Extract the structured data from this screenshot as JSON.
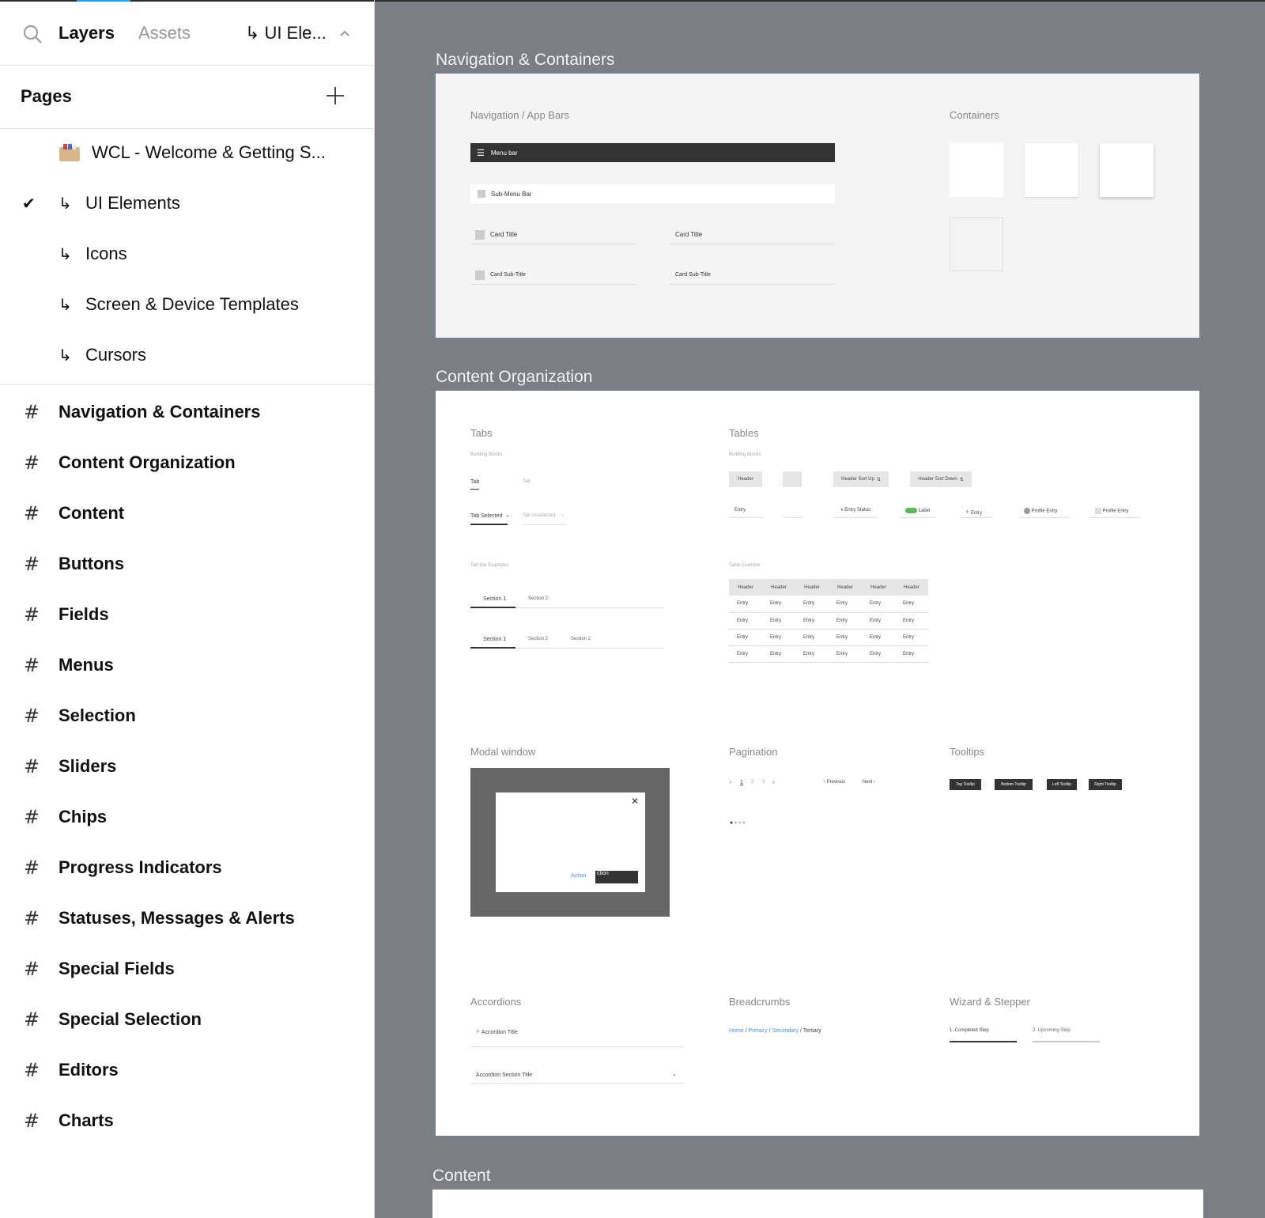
{
  "sidebar": {
    "tabs": {
      "layers": "Layers",
      "assets": "Assets"
    },
    "page_switch": {
      "arrow": "↳",
      "label": "UI Ele...",
      "chevron": "^"
    },
    "pages_title": "Pages",
    "pages": [
      {
        "label": "WCL - Welcome & Getting S...",
        "icon": "folder-icon",
        "checked": false
      },
      {
        "label": "UI Elements",
        "icon": "subpage-arrow-icon",
        "checked": true
      },
      {
        "label": "Icons",
        "icon": "subpage-arrow-icon",
        "checked": false
      },
      {
        "label": "Screen & Device Templates",
        "icon": "subpage-arrow-icon",
        "checked": false
      },
      {
        "label": "Cursors",
        "icon": "subpage-arrow-icon",
        "checked": false
      }
    ],
    "arrow_glyph": "↳",
    "check_glyph": "✔",
    "hash_glyph": "#",
    "frames": [
      "Navigation & Containers",
      "Content Organization",
      "Content",
      "Buttons",
      "Fields",
      "Menus",
      "Selection",
      "Sliders",
      "Chips",
      "Progress Indicators",
      "Statuses, Messages & Alerts",
      "Special Fields",
      "Special Selection",
      "Editors",
      "Charts"
    ]
  },
  "canvas": {
    "frame_labels": {
      "nav": "Navigation & Containers",
      "content_org": "Content Organization",
      "content": "Content"
    },
    "nav": {
      "nav_title": "Navigation / App Bars",
      "containers_title": "Containers",
      "menu_bar": "Menu bar",
      "sub_menu_bar": "Sub-Menu Bar",
      "card_title": "Card Title",
      "card_subtitle": "Card Sub-Title"
    },
    "content_org": {
      "tabs_title": "Tabs",
      "tables_title": "Tables",
      "building_blocks": "Building Blocks",
      "tab": "Tab",
      "tab_selected": "Tab Selected",
      "tab_unselected": "Tab Unselected",
      "tab_bar_examples": "Tab Bar Examples",
      "section1": "Section 1",
      "section2": "Section 2",
      "header": "Header",
      "header_sort_up": "Header Sort Up",
      "header_sort_down": "Header Sort Down",
      "entry": "Entry",
      "entry_status": "Entry Status",
      "label": "Label",
      "profile_entry": "Profile Entry",
      "table_example": "Table Example",
      "modal_title": "Modal window",
      "modal_action": "Action",
      "modal_action_btn": "ction",
      "pagination_title": "Pagination",
      "pages": [
        "1",
        "2",
        "3"
      ],
      "previous": "Previous",
      "next": "Next",
      "tooltips_title": "Tooltips",
      "tooltips": [
        "Top Tooltip",
        "Bottom Tooltip",
        "Left Tooltip",
        "Right Tooltip"
      ],
      "accordions_title": "Accordions",
      "accordion_title": "Accordion Title",
      "accordion_section_title": "Accordion Section Title",
      "breadcrumbs_title": "Breadcrumbs",
      "breadcrumbs": [
        "Home",
        "Primary",
        "Secondary",
        "Tertiary"
      ],
      "wizard_title": "Wizard & Stepper",
      "step1": "1. Completed Step",
      "step2": "2. Upcoming Step"
    },
    "colors": {
      "canvas_bg": "#7b7e85",
      "accent_blue": "#18a0fb",
      "dark": "#333333"
    }
  }
}
